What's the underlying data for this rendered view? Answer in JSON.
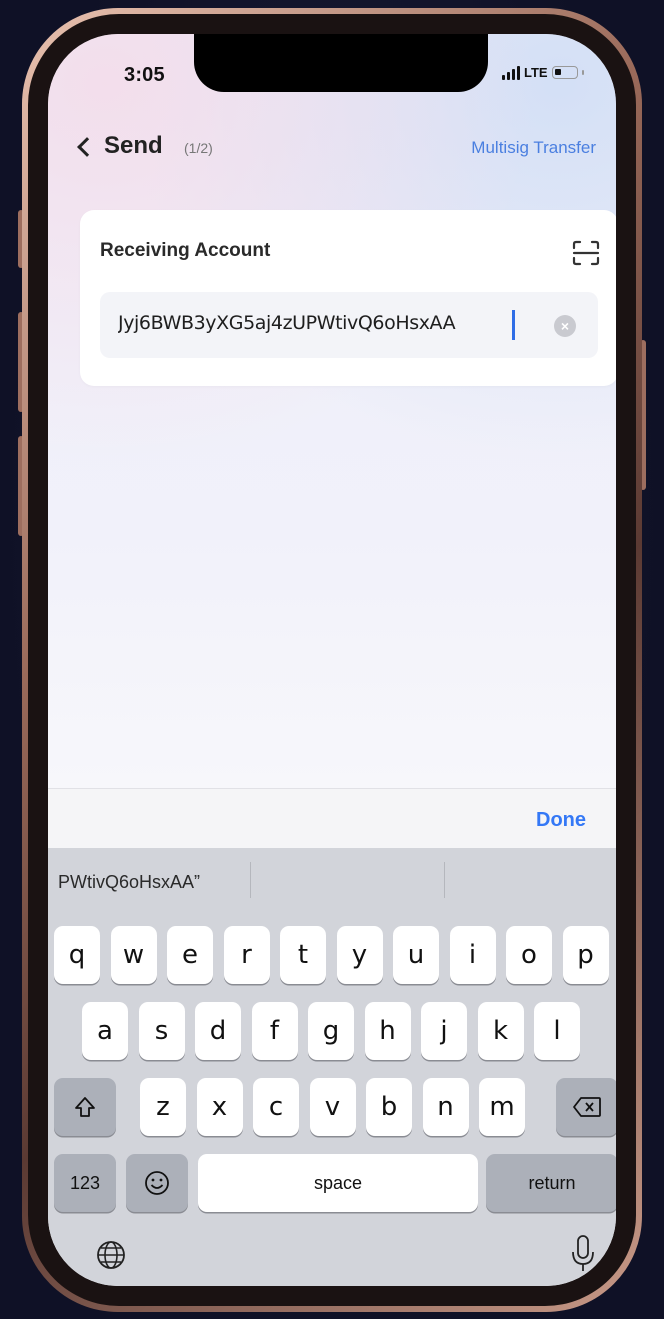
{
  "status_bar": {
    "time": "3:05",
    "network": "LTE"
  },
  "nav": {
    "title": "Send",
    "step": "(1/2)",
    "action": "Multisig Transfer",
    "back_icon": "chevron-left-icon"
  },
  "receiving": {
    "label": "Receiving Account",
    "scan_icon": "scan-icon",
    "value": "Jyj6BWB3yXG5aj4zUPWtivQ6oHsxAA",
    "clear_icon": "clear-circle-icon"
  },
  "keyboard": {
    "done_label": "Done",
    "suggestion": "PWtivQ6oHsxAA”",
    "row1": [
      "q",
      "w",
      "e",
      "r",
      "t",
      "y",
      "u",
      "i",
      "o",
      "p"
    ],
    "row2": [
      "a",
      "s",
      "d",
      "f",
      "g",
      "h",
      "j",
      "k",
      "l"
    ],
    "row3": [
      "z",
      "x",
      "c",
      "v",
      "b",
      "n",
      "m"
    ],
    "numbers_label": "123",
    "space_label": "space",
    "return_label": "return",
    "shift_icon": "shift-icon",
    "delete_icon": "delete-icon",
    "emoji_icon": "emoji-icon",
    "globe_icon": "globe-icon",
    "mic_icon": "microphone-icon"
  },
  "colors": {
    "accent": "#3478f6",
    "link": "#4a7fe0"
  }
}
